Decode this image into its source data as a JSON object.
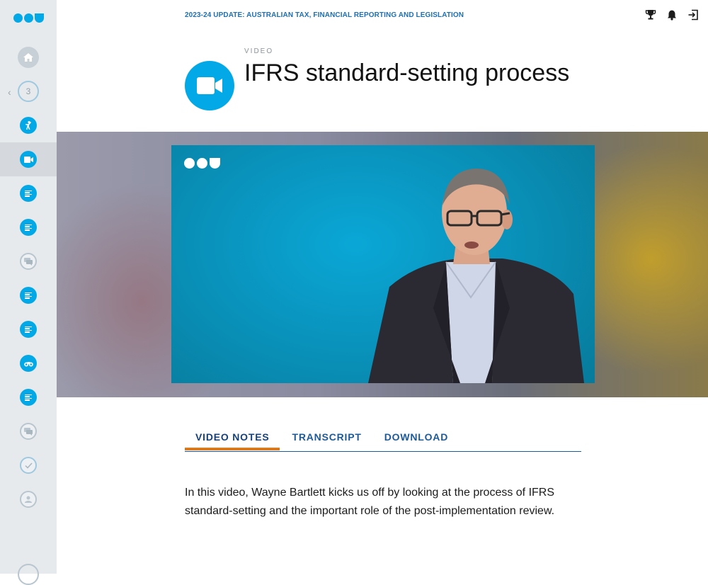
{
  "header": {
    "course_title": "2023-24 UPDATE: AUSTRALIAN TAX, FINANCIAL REPORTING AND LEGISLATION",
    "icons": [
      "trophy-icon",
      "bell-icon",
      "logout-icon"
    ]
  },
  "page": {
    "kind_label": "VIDEO",
    "title": "IFRS standard-setting process",
    "badge_icon": "video-camera-icon"
  },
  "sidebar": {
    "items": [
      {
        "icon": "home-icon",
        "state": "neutral"
      },
      {
        "icon": "module-progress-ring",
        "label": "3",
        "state": "current-module"
      },
      {
        "icon": "activity-icon",
        "state": "available"
      },
      {
        "icon": "video-icon",
        "state": "active"
      },
      {
        "icon": "document-icon",
        "state": "available"
      },
      {
        "icon": "document-icon",
        "state": "available"
      },
      {
        "icon": "discussion-icon",
        "state": "locked"
      },
      {
        "icon": "document-icon",
        "state": "available"
      },
      {
        "icon": "document-icon",
        "state": "available"
      },
      {
        "icon": "binoculars-icon",
        "state": "available"
      },
      {
        "icon": "document-icon",
        "state": "available"
      },
      {
        "icon": "discussion-icon",
        "state": "locked"
      },
      {
        "icon": "check-icon",
        "state": "locked"
      },
      {
        "icon": "certificate-icon",
        "state": "locked"
      }
    ]
  },
  "video": {
    "has_logo": true
  },
  "tabs": [
    {
      "label": "VIDEO NOTES",
      "active": true
    },
    {
      "label": "TRANSCRIPT",
      "active": false
    },
    {
      "label": "DOWNLOAD",
      "active": false
    }
  ],
  "notes": {
    "text": "In this video, Wayne Bartlett kicks us off by looking at the process of IFRS standard-setting and the important role of the post-implementation review."
  },
  "colors": {
    "accent_blue": "#03a9e6",
    "nav_blue": "#1e5a9a",
    "tab_underline": "#d97a1e",
    "sidebar_bg": "#e6eaed"
  }
}
